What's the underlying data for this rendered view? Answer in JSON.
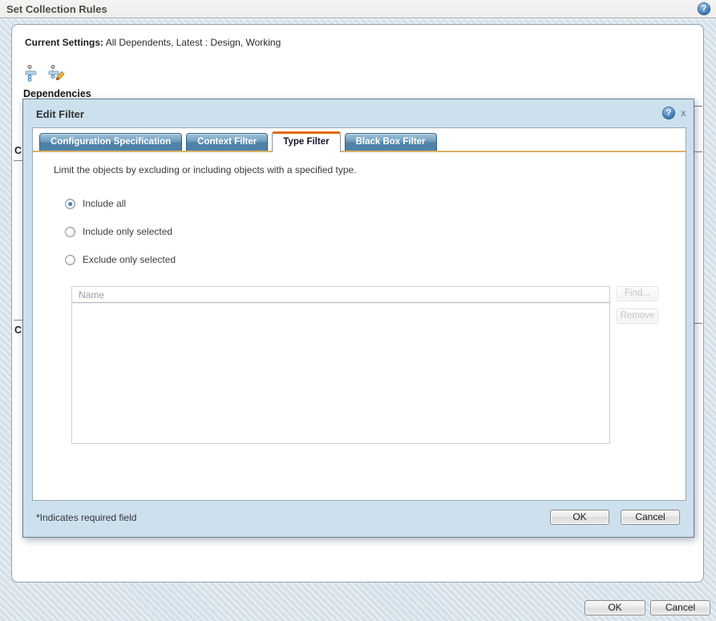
{
  "page": {
    "title": "Set Collection Rules",
    "help_glyph": "?",
    "ok_label": "OK",
    "cancel_label": "Cancel"
  },
  "settings_panel": {
    "current_settings_label": "Current Settings:",
    "current_settings_value": "All Dependents, Latest : Design, Working",
    "toolbar_icons": [
      "dependencies-tree-icon",
      "edit-dependencies-tree-icon"
    ],
    "dependencies_label": "Dependencies",
    "hidden_fragment_1": "C",
    "hidden_fragment_2": "C"
  },
  "edit_filter_dialog": {
    "title": "Edit Filter",
    "help_glyph": "?",
    "close_label": "x",
    "tabs": {
      "configuration_specification": "Configuration Specification",
      "context_filter": "Context Filter",
      "type_filter": "Type Filter",
      "black_box_filter": "Black Box Filter",
      "active_tab": "Type Filter"
    },
    "description": "Limit the objects by excluding or including objects with a specified type.",
    "radios": {
      "include_all": "Include all",
      "include_only_selected": "Include only selected",
      "exclude_only_selected": "Exclude only selected",
      "selected": "Include all"
    },
    "list": {
      "column_header": "Name",
      "rows": []
    },
    "find_label": "Find...",
    "remove_label": "Remove",
    "footer_note": "*Indicates required field",
    "ok_label": "OK",
    "cancel_label": "Cancel"
  },
  "colors": {
    "dialog_blue": "#cde0ee",
    "active_tab_accent": "#e8680f",
    "tab_blue_top": "#a3c5da",
    "tab_blue_bottom": "#4f84a8",
    "tab_underline_gold": "#dcb266",
    "help_icon_blue": "#4c86bd"
  }
}
